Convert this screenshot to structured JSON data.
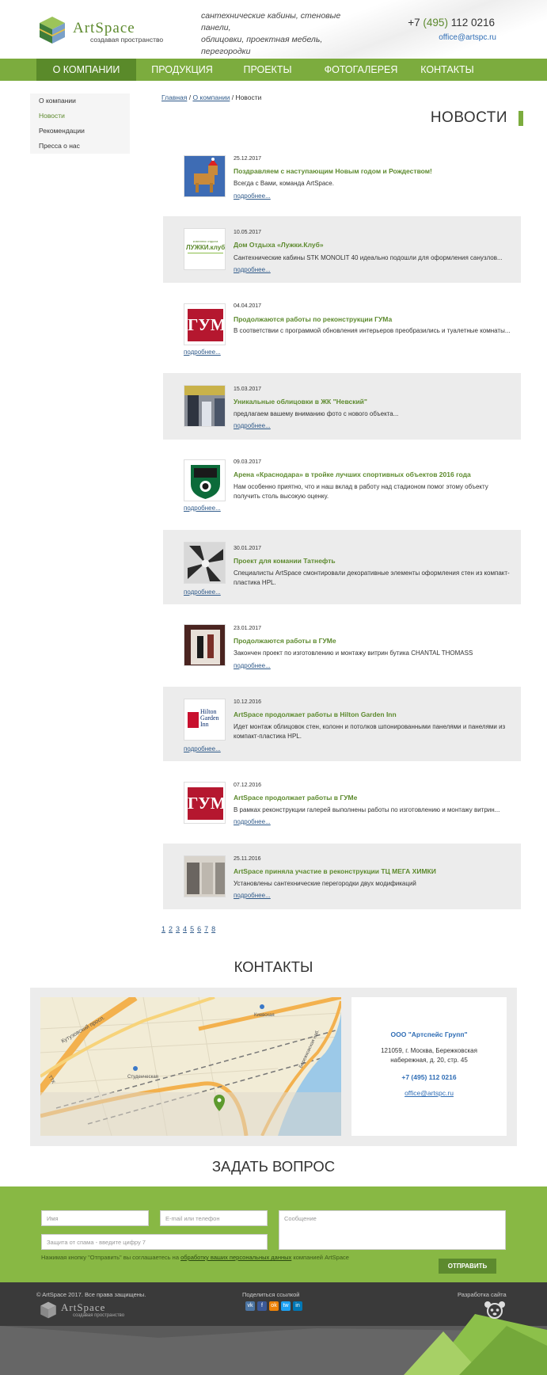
{
  "header": {
    "logo_name": "ArtSpace",
    "logo_subtitle": "создавая пространство",
    "tagline_line1": "сантехнические кабины, стеновые панели,",
    "tagline_line2": "облицовки, проектная мебель, перегородки",
    "phone_prefix": "+7 ",
    "phone_code": "(495)",
    "phone_number": " 112 0216",
    "email": "office@artspc.ru"
  },
  "nav": {
    "items": [
      "О компании",
      "Продукция",
      "Проекты",
      "Фотогалерея",
      "Контакты"
    ]
  },
  "sidebar": {
    "items": [
      "О компании",
      "Новости",
      "Рекомендации",
      "Пресса о нас"
    ]
  },
  "breadcrumb": {
    "home": "Главная",
    "sep1": " / ",
    "section": "О компании",
    "sep2": " / ",
    "current": "Новости"
  },
  "page_title": "НОВОСТИ",
  "more_label": "подробнее...",
  "news": [
    {
      "date": "25.12.2017",
      "title": "Поздравляем с наступающим Новым годом и Рождеством!",
      "text": "Всегда с Вами,  команда ArtSpace."
    },
    {
      "date": "10.05.2017",
      "title": "Дом Отдыха «Лужки.Клуб»",
      "text": "Сантехнические кабины STK MONOLIT 40 идеально подошли для оформления санузлов..."
    },
    {
      "date": "04.04.2017",
      "title": "Продолжаются работы по реконструкции ГУМа",
      "text": "В соответствии с программой обновления интерьеров преобразились и туалетные комнаты..."
    },
    {
      "date": "15.03.2017",
      "title": "Уникальные облицовки в ЖК \"Невский\"",
      "text": "предлагаем вашему вниманию фото с нового объекта..."
    },
    {
      "date": "09.03.2017",
      "title": "Арена «Краснодара» в тройке лучших спортивных объектов 2016 года",
      "text": "Нам особенно приятно, что и наш вклад в работу над стадионом помог этому объекту получить столь высокую оценку."
    },
    {
      "date": "30.01.2017",
      "title": "Проект для комании Татнефть",
      "text": "Специалисты ArtSpace смонтировали декоративные элементы оформления стен из компакт-пластика HPL."
    },
    {
      "date": "23.01.2017",
      "title": "Продолжаются работы в ГУМе",
      "text": "Закончен проект по изготовлению и монтажу витрин бутика CHANTAL THOMASS"
    },
    {
      "date": "10.12.2016",
      "title": "ArtSpace продолжает работы в Hilton Garden Inn",
      "text": "Идет монтаж облицовок стен, колонн и потолков шпонированными панелями и панелями из компакт-пластика HPL."
    },
    {
      "date": "07.12.2016",
      "title": "ArtSpace продолжает работы в ГУМе",
      "text": "В рамках реконструкции галерей выполнены работы по изготовлению и монтажу витрин..."
    },
    {
      "date": "25.11.2016",
      "title": "ArtSpace приняла участие в реконструкции ТЦ МЕГА ХИМКИ",
      "text": "Установлены сантехнические перегородки двух модификаций"
    }
  ],
  "thumb_labels": {
    "luzhki_top": "комплекс отдыха",
    "luzhki_main": "ЛУЖКИ.клуб",
    "gum": "ГУМ",
    "hilton": "Hilton Garden Inn"
  },
  "pager": [
    "1",
    "2",
    "3",
    "4",
    "5",
    "6",
    "7",
    "8"
  ],
  "contacts": {
    "title": "КОНТАКТЫ",
    "company": "ООО \"Артспейс Групп\"",
    "address_line1": "121059, г. Москва, Бережковская",
    "address_line2": "набережная, д. 20, стр. 45",
    "phone": "+7 (495) 112 0216",
    "email": "office@artspc.ru",
    "map_labels": [
      "Кутузовский просп.",
      "Киевская",
      "Студенческая",
      "Бережковская наб.",
      "ТТК"
    ]
  },
  "ask": {
    "title": "ЗАДАТЬ ВОПРОС",
    "name_placeholder": "Имя",
    "contact_placeholder": "E-mail или телефон",
    "message_placeholder": "Сообщение",
    "captcha_placeholder": "Защита от спама - введите цифру 7",
    "agree_before": "Нажимая кнопку \"Отправить\" вы соглашаетесь на ",
    "agree_link": "обработку ваших персональных данных",
    "agree_after": " компанией ArtSpace",
    "send_label": "ОТПРАВИТЬ"
  },
  "footer": {
    "copyright": "© ArtSpace 2017. Все права защищены.",
    "logo_name": "ArtSpace",
    "logo_subtitle": "создавая пространство",
    "share_label": "Поделиться ссылкой",
    "share_icons": [
      "vk",
      "f",
      "ok",
      "tw",
      "in"
    ],
    "dev_label": "Разработка сайта"
  },
  "colors": {
    "accent": "#7cac3e",
    "accent_dark": "#5d8a2e",
    "link": "#2f5a8a"
  }
}
